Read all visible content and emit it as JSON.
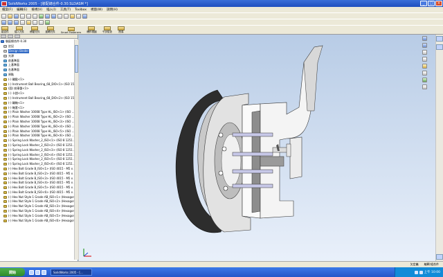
{
  "window": {
    "title": "SolidWorks 2005 - [裝配總合件-0.30.SLDASM *]"
  },
  "menu": [
    "檔案(F)",
    "編輯(E)",
    "檢視(V)",
    "插入(I)",
    "工具(T)",
    "Toolbox",
    "視窗(W)",
    "說明(H)"
  ],
  "feature_toolbar": [
    "組合件",
    "插入元件",
    "移動元件",
    "旋轉元件",
    "Smart Fasteners",
    "爆炸視圖",
    "干涉檢查",
    "簡易"
  ],
  "tree": {
    "items": [
      {
        "label": "裝配總合件-0.30",
        "icon": "assembly-icon"
      },
      {
        "label": "註記",
        "icon": "annotations-icon"
      },
      {
        "label": "Design Binder",
        "icon": "folder-icon"
      },
      {
        "label": "光源",
        "icon": "lighting-icon"
      },
      {
        "label": "前基準面",
        "icon": "plane-icon"
      },
      {
        "label": "上基準面",
        "icon": "plane-icon"
      },
      {
        "label": "右基準面",
        "icon": "plane-icon"
      },
      {
        "label": "原點",
        "icon": "origin-icon"
      },
      {
        "label": "(-) 輪轂<1>",
        "icon": "part-icon"
      },
      {
        "label": "(-) Instrument Ball Bearing_68_DIO<1> (ISO 15 …",
        "icon": "part-icon"
      },
      {
        "label": "(固) 剎車盤<1>",
        "icon": "part-icon"
      },
      {
        "label": "(-) 卡鉗<1>",
        "icon": "part-icon"
      },
      {
        "label": "(-) Instrument Ball Bearing_68_DIO<2> (ISO 15 …",
        "icon": "part-icon"
      },
      {
        "label": "(-) 輪軸<1>",
        "icon": "part-icon"
      },
      {
        "label": "(-) 軸套<1>",
        "icon": "part-icon"
      },
      {
        "label": "(-) Plain Washer 10008 Type HL_ISO<1> (ISO …",
        "icon": "part-icon"
      },
      {
        "label": "(-) Plain Washer 10008 Type HL_ISO<2> (ISO …",
        "icon": "part-icon"
      },
      {
        "label": "(-) Plain Washer 10008 Type HL_ISO<3> (ISO …",
        "icon": "part-icon"
      },
      {
        "label": "(-) Plain Washer 10008 Type HL_ISO<4> (ISO …",
        "icon": "part-icon"
      },
      {
        "label": "(-) Plain Washer 10008 Type HL_ISO<5> (ISO …",
        "icon": "part-icon"
      },
      {
        "label": "(-) Plain Washer 10008 Type HL_ISO<6> (ISO …",
        "icon": "part-icon"
      },
      {
        "label": "(-) Spring Lock Washer_2_ISO<1> (ISO 8 1251 …",
        "icon": "part-icon"
      },
      {
        "label": "(-) Spring Lock Washer_2_ISO<2> (ISO 8 1251 …",
        "icon": "part-icon"
      },
      {
        "label": "(-) Spring Lock Washer_2_ISO<3> (ISO 8 1251 …",
        "icon": "part-icon"
      },
      {
        "label": "(-) Spring Lock Washer_2_ISO<4> (ISO 8 1251 …",
        "icon": "part-icon"
      },
      {
        "label": "(-) Spring Lock Washer_2_ISO<5> (ISO 8 1251 …",
        "icon": "part-icon"
      },
      {
        "label": "(-) Spring Lock Washer_2_ISO<6> (ISO 8 1251 …",
        "icon": "part-icon"
      },
      {
        "label": "(-) Hex Bolt Grade B_ISO<1> (ISO 4015 - M5 x …",
        "icon": "part-icon"
      },
      {
        "label": "(-) Hex Bolt Grade B_ISO<2> (ISO 4015 - M5 x …",
        "icon": "part-icon"
      },
      {
        "label": "(-) Hex Bolt Grade B_ISO<3> (ISO 4015 - M5 x …",
        "icon": "part-icon"
      },
      {
        "label": "(-) Hex Bolt Grade B_ISO<4> (ISO 4015 - M5 x …",
        "icon": "part-icon"
      },
      {
        "label": "(-) Hex Bolt Grade B_ISO<5> (ISO 4015 - M5 x …",
        "icon": "part-icon"
      },
      {
        "label": "(-) Hex Bolt Grade B_ISO<6> (ISO 4015 - M5 x …",
        "icon": "part-icon"
      },
      {
        "label": "(-) Hex Nut Style 1 Grade AB_ISO<1> (Hexagon …",
        "icon": "part-icon"
      },
      {
        "label": "(-) Hex Nut Style 1 Grade AB_ISO<2> (Hexagon …",
        "icon": "part-icon"
      },
      {
        "label": "(-) Hex Nut Style 1 Grade AB_ISO<3> (Hexagon …",
        "icon": "part-icon"
      },
      {
        "label": "(-) Hex Nut Style 1 Grade AB_ISO<4> (Hexagon …",
        "icon": "part-icon"
      },
      {
        "label": "(-) Hex Nut Style 1 Grade AB_ISO<5> (Hexagon …",
        "icon": "part-icon"
      },
      {
        "label": "(-) Hex Nut Style 1 Grade AB_ISO<6> (Hexagon …",
        "icon": "part-icon"
      }
    ]
  },
  "status": {
    "state": "欠定義",
    "mode": "編輯:組合件"
  },
  "taskbar": {
    "start": "開始",
    "tasks": [
      "SolidWorks 2005 - [..."
    ],
    "clock": "上午 10:00"
  },
  "colors": {
    "title_bar": "#1f4fbf",
    "viewport_top": "#b8cce6",
    "selection": "#316ac5",
    "taskbar": "#2456c8"
  }
}
